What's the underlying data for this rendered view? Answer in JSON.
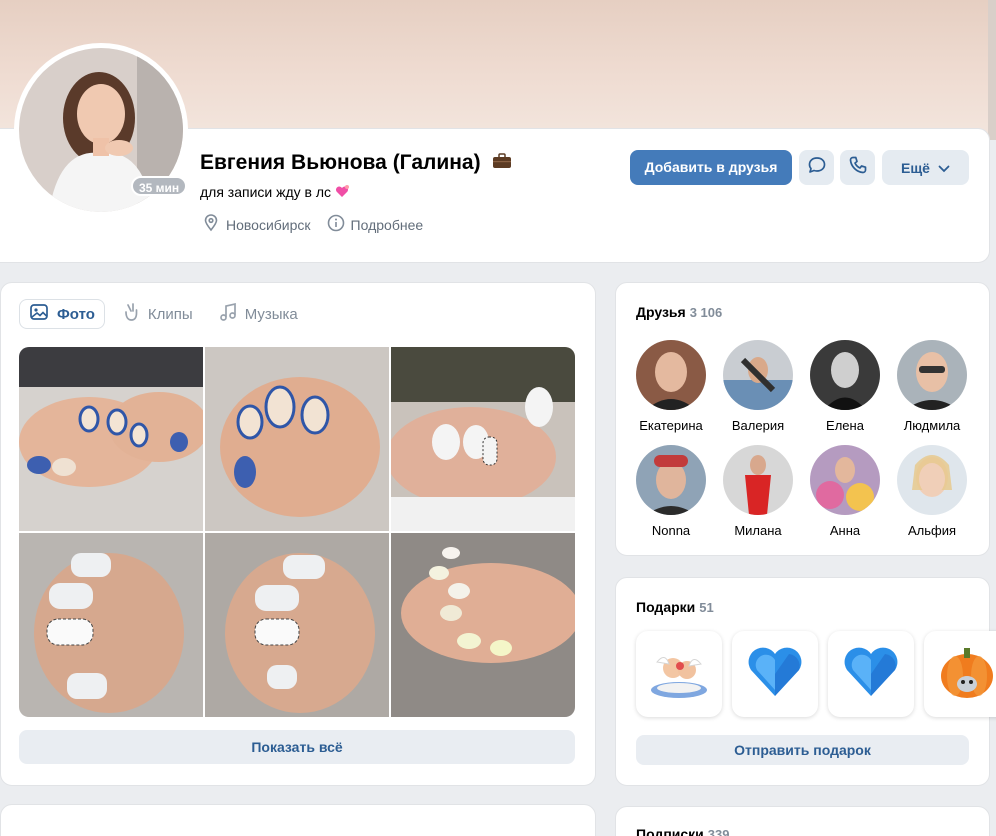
{
  "profile": {
    "name": "Евгения Вьюнова (Галина)",
    "status": "для записи жду в лс",
    "online": "35 мин",
    "city": "Новосибирск",
    "details": "Подробнее",
    "add_friend": "Добавить в друзья",
    "more": "Ещё"
  },
  "media": {
    "tabs": [
      {
        "label": "Фото",
        "icon": "photo-icon"
      },
      {
        "label": "Клипы",
        "icon": "clips-icon"
      },
      {
        "label": "Музыка",
        "icon": "music-icon"
      }
    ],
    "show_all": "Показать всё"
  },
  "friends": {
    "title": "Друзья",
    "count": "3 106",
    "list": [
      {
        "name": "Екатерина"
      },
      {
        "name": "Валерия"
      },
      {
        "name": "Елена"
      },
      {
        "name": "Людмила"
      },
      {
        "name": "Nonna"
      },
      {
        "name": "Милана"
      },
      {
        "name": "Анна"
      },
      {
        "name": "Альфия"
      }
    ]
  },
  "gifts": {
    "title": "Подарки",
    "count": "51",
    "send": "Отправить подарок"
  },
  "bottom": {
    "subscriptions": "Подписки",
    "subscriptions_count": "339"
  },
  "colors": {
    "accent": "#447bba",
    "link": "#2c5d93",
    "secondary_text": "#818c99"
  }
}
